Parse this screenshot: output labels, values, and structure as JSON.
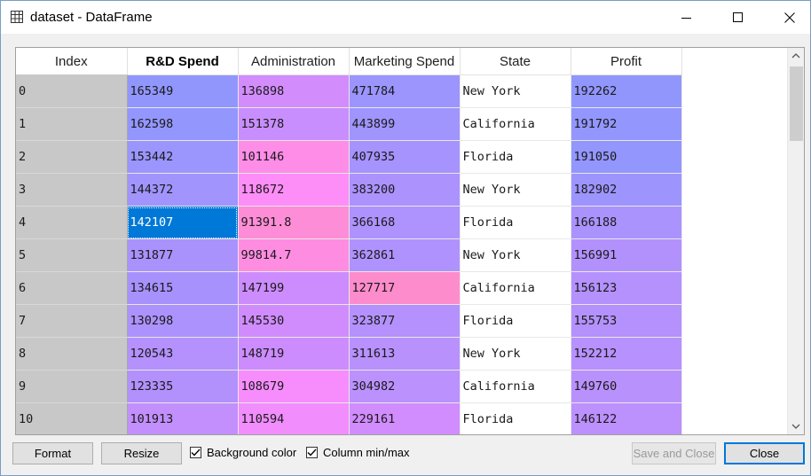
{
  "window": {
    "title": "dataset - DataFrame",
    "title_icon": "table-grid-icon",
    "controls": [
      "minimize-icon",
      "maximize-icon",
      "close-icon"
    ]
  },
  "table": {
    "headers": [
      "Index",
      "R&D Spend",
      "Administration",
      "Marketing Spend",
      "State",
      "Profit"
    ],
    "rows": [
      {
        "index": "0",
        "rd": "165349",
        "admin": "136898",
        "marketing": "471784",
        "state": "New York",
        "profit": "192262"
      },
      {
        "index": "1",
        "rd": "162598",
        "admin": "151378",
        "marketing": "443899",
        "state": "California",
        "profit": "191792"
      },
      {
        "index": "2",
        "rd": "153442",
        "admin": "101146",
        "marketing": "407935",
        "state": "Florida",
        "profit": "191050"
      },
      {
        "index": "3",
        "rd": "144372",
        "admin": "118672",
        "marketing": "383200",
        "state": "New York",
        "profit": "182902"
      },
      {
        "index": "4",
        "rd": "142107",
        "admin": "91391.8",
        "marketing": "366168",
        "state": "Florida",
        "profit": "166188"
      },
      {
        "index": "5",
        "rd": "131877",
        "admin": "99814.7",
        "marketing": "362861",
        "state": "New York",
        "profit": "156991"
      },
      {
        "index": "6",
        "rd": "134615",
        "admin": "147199",
        "marketing": "127717",
        "state": "California",
        "profit": "156123"
      },
      {
        "index": "7",
        "rd": "130298",
        "admin": "145530",
        "marketing": "323877",
        "state": "Florida",
        "profit": "155753"
      },
      {
        "index": "8",
        "rd": "120543",
        "admin": "148719",
        "marketing": "311613",
        "state": "New York",
        "profit": "152212"
      },
      {
        "index": "9",
        "rd": "123335",
        "admin": "108679",
        "marketing": "304982",
        "state": "California",
        "profit": "149760"
      },
      {
        "index": "10",
        "rd": "101913",
        "admin": "110594",
        "marketing": "229161",
        "state": "Florida",
        "profit": "146122"
      }
    ],
    "cell_colors": {
      "rd": [
        "#9196fd",
        "#9396fd",
        "#9a96fd",
        "#a194fd",
        "#0078d7",
        "#aa92fd",
        "#a792fd",
        "#ac92fd",
        "#b591fd",
        "#b291fd",
        "#c28ffd"
      ],
      "admin": [
        "#d38cfc",
        "#c88efd",
        "#fe8de8",
        "#fd8df7",
        "#fd8dd6",
        "#fe8de1",
        "#cd8cfd",
        "#d08cfd",
        "#cc8cfd",
        "#f78dfd",
        "#f18dfd"
      ],
      "marketing": [
        "#9b95fd",
        "#a094fd",
        "#a693fd",
        "#ab92fd",
        "#ae92fd",
        "#af92fd",
        "#fd8ccc",
        "#b491fd",
        "#b891fd",
        "#ba91fd",
        "#d18cfd"
      ],
      "profit": [
        "#9196fd",
        "#9296fd",
        "#9396fd",
        "#9d95fd",
        "#aa93fd",
        "#b391fd",
        "#b491fd",
        "#b491fd",
        "#b791fd",
        "#b991fd",
        "#bc90fd"
      ]
    },
    "selected_cell": {
      "row": 4,
      "column": "rd"
    }
  },
  "footer": {
    "format_label": "Format",
    "resize_label": "Resize",
    "bg_color_label": "Background color",
    "bg_color_checked": true,
    "minmax_label": "Column min/max",
    "minmax_checked": true,
    "save_close_label": "Save and Close",
    "close_label": "Close"
  }
}
